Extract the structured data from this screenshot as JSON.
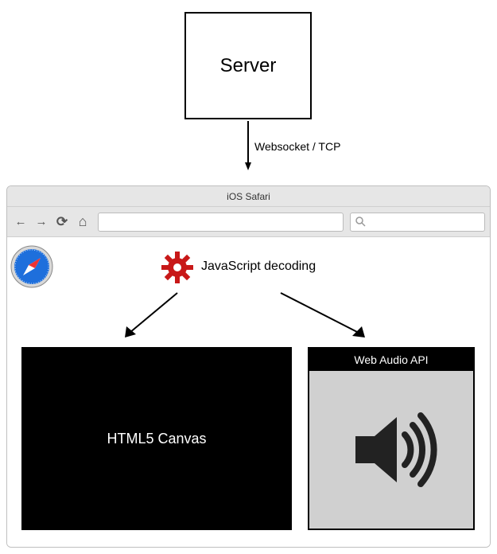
{
  "server": {
    "label": "Server"
  },
  "link": {
    "label": "Websocket / TCP"
  },
  "browser": {
    "title": "iOS Safari",
    "toolbar": {
      "back": "←",
      "fwd": "→",
      "reload": "⟳",
      "home": "⌂",
      "search_placeholder": "Search"
    }
  },
  "decode": {
    "label": "JavaScript decoding"
  },
  "canvas": {
    "label": "HTML5 Canvas"
  },
  "audio": {
    "title": "Web Audio API"
  }
}
